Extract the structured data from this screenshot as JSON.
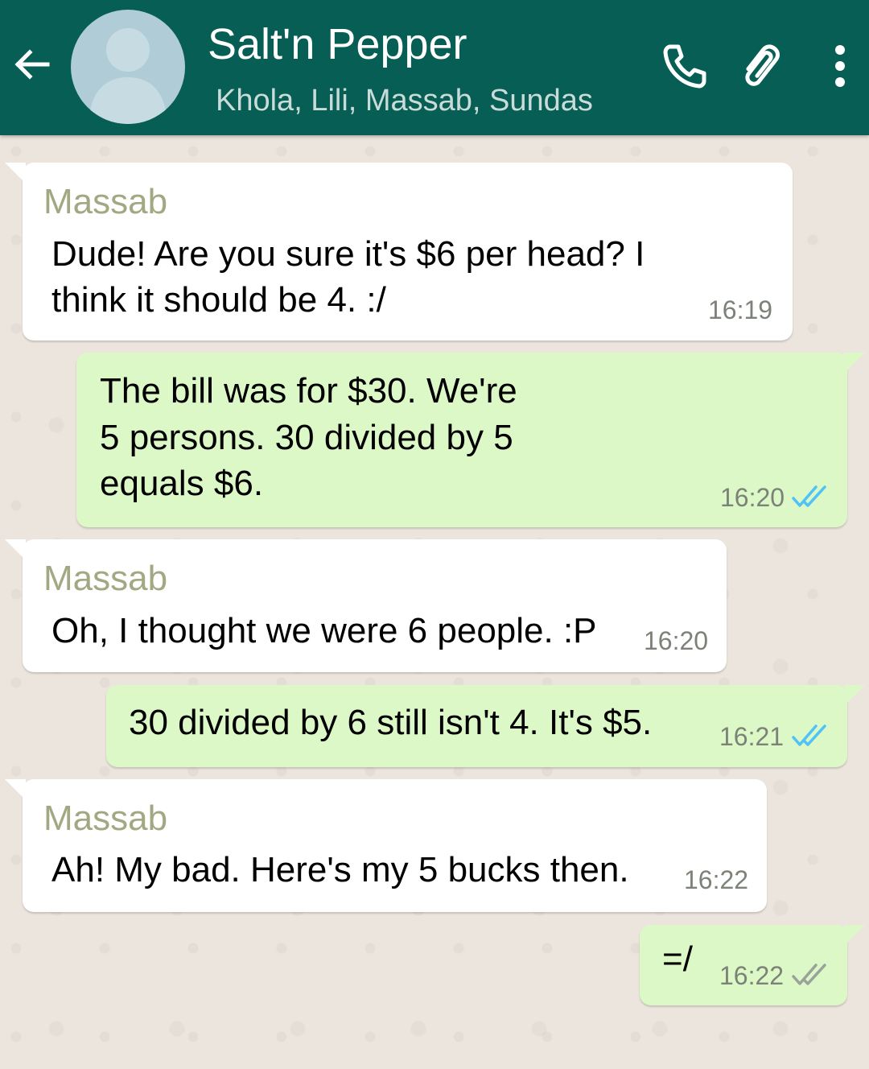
{
  "header": {
    "title": "Salt'n Pepper",
    "subtitle": "Khola, Lili, Massab, Sundas",
    "background_color": "#075e54"
  },
  "icons": {
    "back": "arrow-left-icon",
    "avatar": "group-avatar-icon",
    "call": "phone-icon",
    "attach": "paperclip-icon",
    "menu": "more-vert-icon",
    "read_receipt": "double-check-icon"
  },
  "colors": {
    "incoming_bubble": "#ffffff",
    "outgoing_bubble": "#dcf8c6",
    "sender_name": "#a1a882",
    "ticks_read": "#4fc3f7",
    "ticks_delivered": "#9aa39a"
  },
  "messages": [
    {
      "direction": "incoming",
      "sender": "Massab",
      "lines": [
        "Dude! Are you sure it's $6 per head? I",
        "think it should be 4. :/"
      ],
      "time": "16:19"
    },
    {
      "direction": "outgoing",
      "lines": [
        "The bill was for $30. We're",
        "5 persons. 30 divided by 5",
        "equals $6."
      ],
      "time": "16:20",
      "status": "read"
    },
    {
      "direction": "incoming",
      "sender": "Massab",
      "lines": [
        "Oh, I thought we were 6 people. :P"
      ],
      "time": "16:20"
    },
    {
      "direction": "outgoing",
      "lines": [
        "30 divided by 6 still isn't 4. It's $5."
      ],
      "time": "16:21",
      "status": "read"
    },
    {
      "direction": "incoming",
      "sender": "Massab",
      "lines": [
        "Ah! My bad. Here's my 5 bucks then."
      ],
      "time": "16:22"
    },
    {
      "direction": "outgoing",
      "lines": [
        "=/"
      ],
      "time": "16:22",
      "status": "delivered"
    }
  ]
}
